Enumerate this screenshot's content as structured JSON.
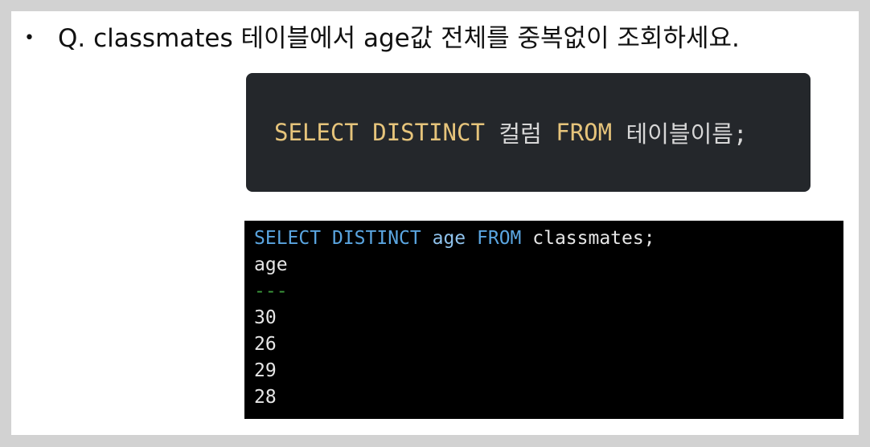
{
  "question": {
    "bullet": "•",
    "text": "Q. classmates 테이블에서 age값 전체를 중복없이 조회하세요."
  },
  "syntax": {
    "select": "SELECT",
    "distinct": "DISTINCT",
    "column": "컬럼",
    "from": "FROM",
    "table": "테이블이름;"
  },
  "terminal": {
    "query": {
      "select": "SELECT",
      "distinct": "DISTINCT",
      "column": "age",
      "from": "FROM",
      "table": "classmates;"
    },
    "header": "age",
    "separator": "---",
    "rows": [
      "30",
      "26",
      "29",
      "28"
    ]
  }
}
